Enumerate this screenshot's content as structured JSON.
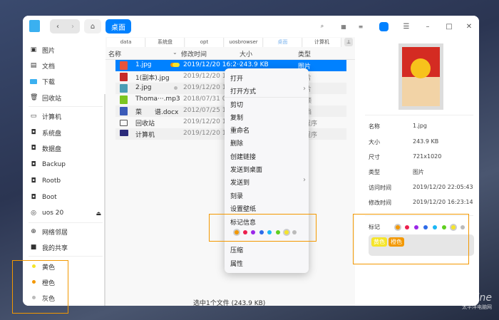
{
  "titlebar": {
    "location_label": "桌面"
  },
  "sidebar": {
    "items": [
      {
        "label": "图片",
        "icon": "image-icon"
      },
      {
        "label": "文档",
        "icon": "document-icon"
      },
      {
        "label": "下载",
        "icon": "download-icon"
      },
      {
        "label": "回收站",
        "icon": "trash-icon"
      },
      {
        "label": "计算机",
        "icon": "computer-icon"
      },
      {
        "label": "系统盘",
        "icon": "disk-icon"
      },
      {
        "label": "数据盘",
        "icon": "disk-icon"
      },
      {
        "label": "Backup",
        "icon": "disk-icon"
      },
      {
        "label": "Rootb",
        "icon": "disk-icon"
      },
      {
        "label": "Boot",
        "icon": "disk-icon"
      },
      {
        "label": "uos 20",
        "icon": "disc-icon"
      },
      {
        "label": "网络邻居",
        "icon": "network-icon"
      },
      {
        "label": "我的共享",
        "icon": "share-folder-icon"
      }
    ],
    "tags": [
      {
        "label": "黄色",
        "color": "#f5e52a"
      },
      {
        "label": "橙色",
        "color": "#f39800"
      },
      {
        "label": "灰色",
        "color": "#bbbbbb"
      }
    ]
  },
  "breadcrumb": [
    "data",
    "系统盘",
    "opt",
    "uosbrowser",
    "桌面",
    "计算机"
  ],
  "columns": [
    "名称",
    "修改时间",
    "大小",
    "类型"
  ],
  "files": [
    {
      "name": "1.jpg",
      "time": "2019/12/20 16:2···",
      "size": "243.9 KB",
      "type": "图片"
    },
    {
      "name": "1(副本).jpg",
      "time": "2019/12/20 16:",
      "size": "",
      "type": "片"
    },
    {
      "name": "2.jpg",
      "time": "2019/12/20 15:",
      "size": "",
      "type": "片"
    },
    {
      "name": "Thoma···.mp3",
      "time": "2018/07/31 09:",
      "size": "",
      "type": "频"
    },
    {
      "name": "菜　　谱.docx",
      "time": "2012/07/25 10:",
      "size": "",
      "type": "档"
    },
    {
      "name": "回收站",
      "time": "2019/12/20 11:",
      "size": "",
      "type": "用程序"
    },
    {
      "name": "计算机",
      "time": "2019/12/20 11:",
      "size": "",
      "type": "用程序"
    }
  ],
  "status": "选中1个文件 (243.9 KB)",
  "context_menu": {
    "items": [
      "打开",
      "打开方式",
      "剪切",
      "复制",
      "重命名",
      "删除",
      "创建链接",
      "发送到桌面",
      "发送到",
      "刻录",
      "设置壁纸",
      "标记信息",
      "压缩",
      "属性"
    ]
  },
  "tag_colors": [
    "#f39800",
    "#ec1e4d",
    "#9b27e8",
    "#2d6be8",
    "#1bb7f5",
    "#5fcf1f",
    "#f5e52a",
    "#bbbbbb"
  ],
  "detail": {
    "labels": [
      "名称",
      "大小",
      "尺寸",
      "类型",
      "访问时间",
      "修改时间"
    ],
    "values": [
      "1.jpg",
      "243.9 KB",
      "721x1020",
      "图片",
      "2019/12/20 22:05:43",
      "2019/12/20 16:23:14"
    ],
    "tag_label": "标记",
    "applied_tags": [
      "黄色",
      "橙色"
    ]
  },
  "watermark": {
    "brand": "PConline",
    "sub": "太平洋电脑网"
  }
}
